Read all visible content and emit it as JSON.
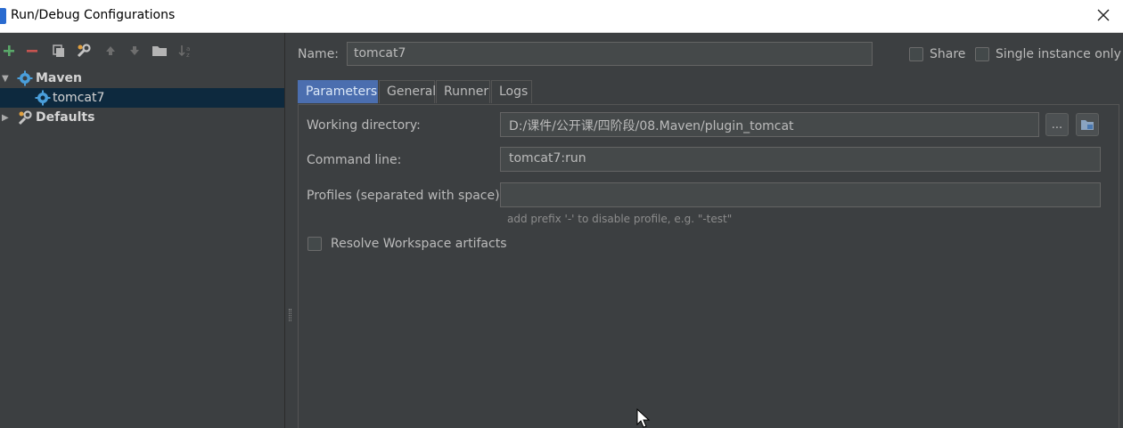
{
  "window": {
    "title": "Run/Debug Configurations"
  },
  "toolbar": {
    "icons": [
      "add-icon",
      "remove-icon",
      "copy-icon",
      "edit-defaults-icon",
      "move-up-icon",
      "move-down-icon",
      "folder-icon",
      "sort-icon"
    ]
  },
  "tree": {
    "maven": {
      "label": "Maven"
    },
    "tomcat7": {
      "label": "tomcat7"
    },
    "defaults": {
      "label": "Defaults"
    }
  },
  "config": {
    "name_label": "Name:",
    "name_value": "tomcat7",
    "share_label": "Share",
    "single_instance_label": "Single instance only"
  },
  "tabs": [
    {
      "label": "Parameters",
      "active": true
    },
    {
      "label": "General"
    },
    {
      "label": "Runner"
    },
    {
      "label": "Logs"
    }
  ],
  "params": {
    "working_dir_label": "Working directory:",
    "working_dir_value": "D:/课件/公开课/四阶段/08.Maven/plugin_tomcat",
    "browse_label": "...",
    "command_label": "Command line:",
    "command_value": "tomcat7:run",
    "profiles_label": "Profiles (separated with space):",
    "profiles_value": "",
    "profiles_hint": "add prefix '-' to disable profile, e.g. \"-test\"",
    "resolve_label": "Resolve Workspace artifacts"
  },
  "colors": {
    "accent": "#4b6eaf",
    "selection": "#0d293e",
    "add": "#59a869",
    "remove": "#c75450"
  }
}
